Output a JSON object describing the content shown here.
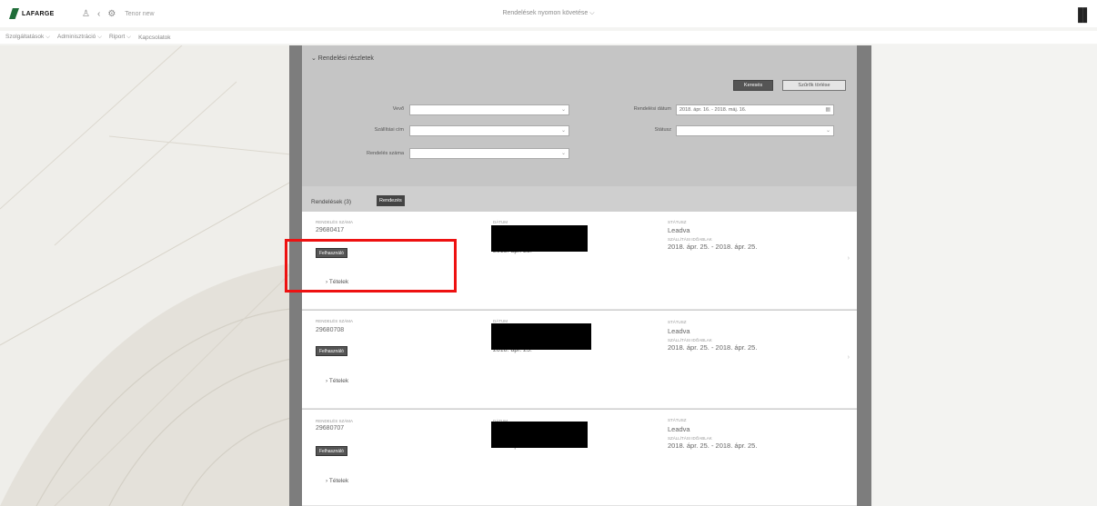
{
  "topbar": {
    "logo_text": "LAFARGE",
    "user_label": "Tenor new",
    "center_title": "Rendelések nyomon követése",
    "center_title_chevron": "⌵",
    "menu_icon": "hamburger-menu-icon"
  },
  "menu": {
    "items": [
      "Szolgáltatások ⌵",
      "Adminisztráció ⌵",
      "Riport ⌵",
      "Kapcsolatok"
    ]
  },
  "filters": {
    "section_title": "⌄ Rendelési részletek",
    "search_button": "Keresés",
    "clear_button": "Szűrők törlése",
    "fields": [
      {
        "label": "Vevő",
        "value": ""
      },
      {
        "label": "Szállítási cím",
        "value": ""
      },
      {
        "label": "Rendelés száma",
        "value": ""
      },
      {
        "label": "Rendelési dátum",
        "value": "2018. ápr. 16. - 2018. máj. 16."
      },
      {
        "label": "Státusz",
        "value": ""
      }
    ]
  },
  "results": {
    "label": "Rendelések (3)",
    "export_button": "Rendezés"
  },
  "orders": [
    {
      "order_caption": "RENDELÉS SZÁMA",
      "order_number": "29680417",
      "info_button": "Felhasználó",
      "col2_caption": "DÁTUM",
      "col2_value": "2018. ápr. 25.",
      "status_caption": "STÁTUSZ",
      "status": "Leadva",
      "window_caption": "SZÁLLÍTÁSI IDŐABLAK",
      "window": "2018. ápr. 25. - 2018. ápr. 25.",
      "items_toggle": "› Tételek"
    },
    {
      "order_caption": "RENDELÉS SZÁMA",
      "order_number": "29680708",
      "info_button": "Felhasználó",
      "col2_caption": "DÁTUM",
      "col2_value": "2018. ápr. 25.",
      "status_caption": "STÁTUSZ",
      "status": "Leadva",
      "window_caption": "SZÁLLÍTÁSI IDŐABLAK",
      "window": "2018. ápr. 25. - 2018. ápr. 25.",
      "items_toggle": "› Tételek"
    },
    {
      "order_caption": "RENDELÉS SZÁMA",
      "order_number": "29680707",
      "info_button": "Felhasználó",
      "col2_caption": "DÁTUM",
      "col2_value": "2018. ápr. 25.",
      "status_caption": "STÁTUSZ",
      "status": "Leadva",
      "window_caption": "SZÁLLÍTÁSI IDŐABLAK",
      "window": "2018. ápr. 25. - 2018. ápr. 25.",
      "items_toggle": "› Tételek"
    }
  ],
  "colors": {
    "brand": "#1f6d39",
    "highlight": "#ee1111",
    "panel_frame": "#7d7d7d"
  }
}
